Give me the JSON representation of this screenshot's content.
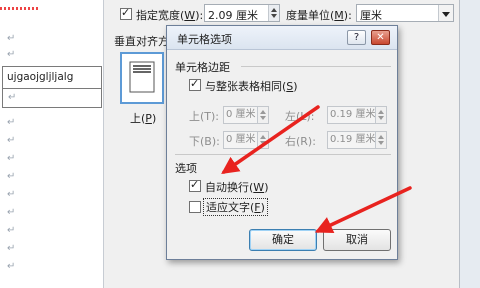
{
  "document": {
    "table_cell_text": "ujgaojgljljalg",
    "paragraph_mark": "↵"
  },
  "table_properties": {
    "preferred_width_label": "指定宽度",
    "preferred_width_key": "W",
    "preferred_width_value": "2.09 厘米",
    "measure_in_label": "度量单位",
    "measure_in_key": "M",
    "measure_in_value": "厘米",
    "vertical_alignment_label": "垂直对齐方式",
    "top_option_label": "上",
    "top_option_key": "P"
  },
  "cell_options_dialog": {
    "title": "单元格选项",
    "help_button": "?",
    "close_button": "✕",
    "cell_margins_section": "单元格边距",
    "same_as_table_label": "与整张表格相同",
    "same_as_table_key": "S",
    "same_as_table_checked": true,
    "margins": {
      "top_label": "上(T):",
      "top_value": "0 厘米",
      "bottom_label": "下(B):",
      "bottom_value": "0 厘米",
      "left_label": "左(L):",
      "left_value": "0.19 厘米",
      "right_label": "右(R):",
      "right_value": "0.19 厘米"
    },
    "options_section": "选项",
    "wrap_text_label": "自动换行",
    "wrap_text_key": "W",
    "wrap_text_checked": true,
    "fit_text_label": "适应文字",
    "fit_text_key": "F",
    "fit_text_checked": false,
    "ok_button": "确定",
    "cancel_button": "取消"
  },
  "colors": {
    "arrow": "#e8231f",
    "title_bar": "#dbe4f0",
    "dialog_face": "#f0f0f0"
  }
}
